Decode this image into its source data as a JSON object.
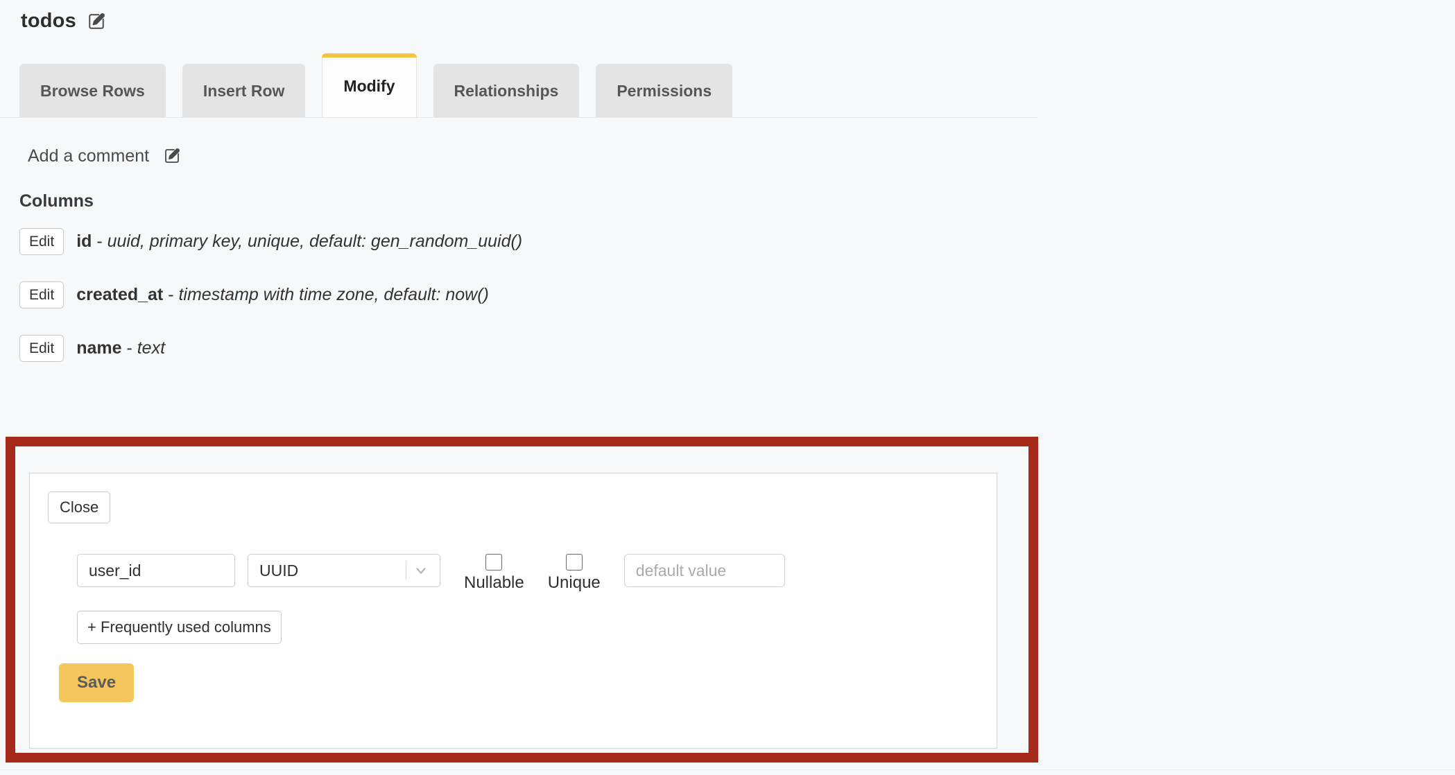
{
  "header": {
    "title": "todos",
    "edit_icon": "edit-pencil-icon"
  },
  "tabs": [
    {
      "label": "Browse Rows",
      "active": false
    },
    {
      "label": "Insert Row",
      "active": false
    },
    {
      "label": "Modify",
      "active": true
    },
    {
      "label": "Relationships",
      "active": false
    },
    {
      "label": "Permissions",
      "active": false
    }
  ],
  "comment": {
    "label": "Add a comment",
    "edit_icon": "edit-pencil-icon"
  },
  "columns_section": {
    "title": "Columns",
    "edit_label": "Edit",
    "rows": [
      {
        "name": "id",
        "sep": " - ",
        "type": "uuid, primary key, unique, default: gen_random_uuid()"
      },
      {
        "name": "created_at",
        "sep": " - ",
        "type": "timestamp with time zone, default: now()"
      },
      {
        "name": "name",
        "sep": " - ",
        "type": "text"
      }
    ]
  },
  "new_column_panel": {
    "close_label": "Close",
    "name_value": "user_id",
    "name_placeholder": "",
    "type_value": "UUID",
    "chevron_icon": "chevron-down-icon",
    "nullable_label": "Nullable",
    "nullable_checked": false,
    "unique_label": "Unique",
    "unique_checked": false,
    "default_value": "",
    "default_placeholder": "default value",
    "frequently_used_label": "+ Frequently used columns",
    "save_label": "Save"
  },
  "colors": {
    "accent_yellow": "#f5c65b",
    "tab_accent": "#f5c342",
    "highlight_red": "#a52a1a",
    "page_bg": "#f7f8fa",
    "tab_inactive_bg": "#e4e4e4"
  }
}
